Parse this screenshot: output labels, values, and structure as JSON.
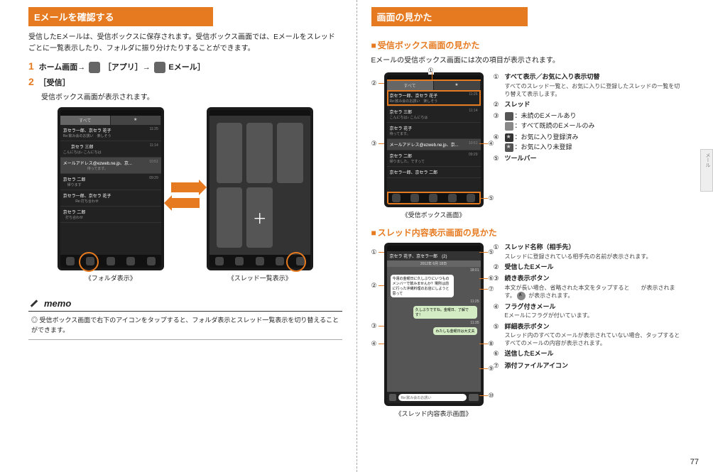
{
  "left": {
    "section_title": "Eメールを確認する",
    "intro": "受信したEメールは、受信ボックスに保存されます。受信ボックス画面では、Eメールをスレッドごとに一覧表示したり、フォルダに振り分けたりすることができます。",
    "step1_num": "1",
    "step1_text": "ホーム画面→［アプリ］→［Eメール］",
    "step2_num": "2",
    "step2_text": "［受信］",
    "step2_sub": "受信ボックス画面が表示されます。",
    "caption_left": "《フォルダ表示》",
    "caption_right": "《スレッド一覧表示》",
    "memo_label": "memo",
    "memo_text": "◎ 受信ボックス画面で右下のアイコンをタップすると、フォルダ表示とスレッド一覧表示を切り替えることができます。",
    "phone": {
      "tab_all": "すべて",
      "tab_star": "★",
      "item1_name": "京セラ一郎、京セラ 花子",
      "item1_sub": "Re:飲み会のお誘い　楽しそう",
      "item1_time": "11:25",
      "item2_name": "京セラ 三郎",
      "item2_sub": "こんにちは♪ こんにちは",
      "item2_time": "11:14",
      "item3_name": "メールアドレス@ezweb.ne.jp、京...",
      "item3_sub": "待ってます。",
      "item3_time": "10:51",
      "item4_name": "京セラ 二郎",
      "item4_sub": "帰ります",
      "item4_time": "09:29",
      "item5_name": "京セラ一郎、京セラ 花子",
      "item5_sub": "Re:打ち合わせ",
      "item6_name": "京セラ 二郎",
      "item6_sub": "打ち合わせ"
    }
  },
  "right": {
    "section_title": "画面の見かた",
    "sub1_title": "受信ボックス画面の見かた",
    "sub1_intro": "Eメールの受信ボックス画面には次の項目が表示されます。",
    "sub1_caption": "《受信ボックス画面》",
    "sub2_title": "スレッド内容表示画面の見かた",
    "sub2_caption": "《スレッド内容表示画面》",
    "labels": {
      "n1": "①",
      "n2": "②",
      "n3": "③",
      "n4": "④",
      "n5": "⑤",
      "n6": "⑥",
      "n7": "⑦",
      "n8": "⑧",
      "n9": "⑨",
      "n10": "⑩"
    },
    "desc1": {
      "d1_title": "すべて表示／お気に入り表示切替",
      "d1_body": "すべてのスレッド一覧と、お気に入りに登録したスレッドの一覧を切り替えて表示します。",
      "d2_title": "スレッド",
      "d3a": "：未読のEメールあり",
      "d3b": "：すべて既読のEメールのみ",
      "d4a": "：お気に入り登録済み",
      "d4b": "：お気に入り未登録",
      "d5_title": "ツールバー"
    },
    "desc2": {
      "d1_title": "スレッド名称（相手先）",
      "d1_body": "スレッドに登録されている相手先の名前が表示されます。",
      "d2_title": "受信したEメール",
      "d3_title": "続き表示ボタン",
      "d3_body": "本文が長い場合、省略された本文をタップすると　　が表示されます。",
      "d4_title": "フラグ付きメール",
      "d4_body": "Eメールにフラグが付いています。",
      "d5_title": "詳細表示ボタン",
      "d5_body": "スレッド内のすべてのメールが表示されていない場合、タップするとすべてのメールの内容が表示されます。",
      "d6_title": "送信したEメール",
      "d7_title": "添付ファイルアイコン"
    },
    "chat": {
      "header": "京セラ 花子、京セラ一郎　(2)",
      "subheader": "2012年 6月 18日",
      "bubble1": "今週の金曜日に久しぶりにいつものメンバーで飲みませんか？場所は前に行った沖縄料理のお店にしようと思って",
      "bubble2": "久しぶりですね。金曜日、了解です！",
      "bubble3": "わたしも金曜日は大丈夫",
      "input_text": "Re:飲み会のお誘い",
      "time1": "11:25",
      "time2": "11:35"
    },
    "page_number": "77",
    "side_tab": "メール"
  }
}
